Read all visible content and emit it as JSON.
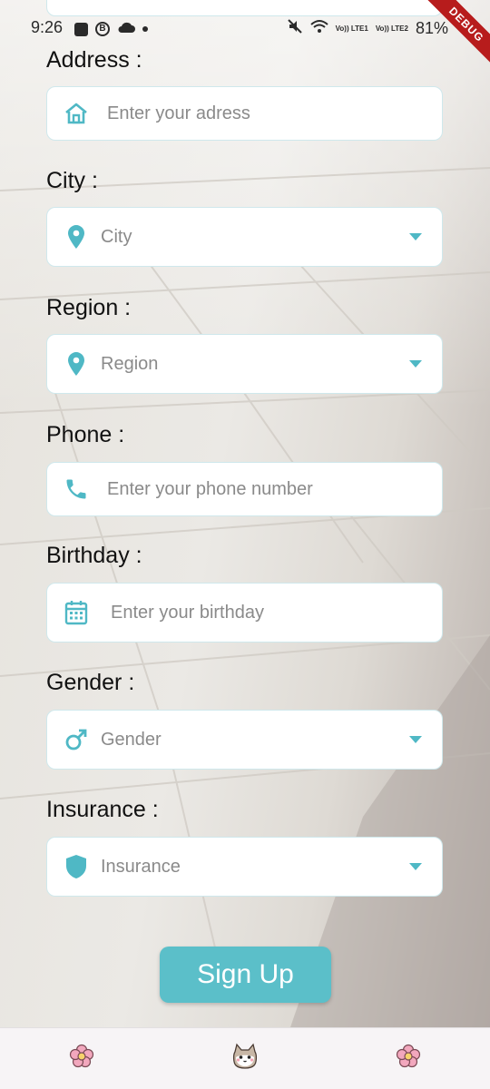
{
  "status_bar": {
    "time": "9:26",
    "battery": "81%",
    "debug_label": "DEBUG",
    "lte1": "Vo)) LTE1",
    "lte2": "Vo)) LTE2"
  },
  "form": {
    "address": {
      "label": "Address :",
      "placeholder": "Enter your adress",
      "icon": "home-icon"
    },
    "city": {
      "label": "City :",
      "placeholder": "City",
      "icon": "location-pin-icon"
    },
    "region": {
      "label": "Region :",
      "placeholder": "Region",
      "icon": "location-pin-icon"
    },
    "phone": {
      "label": "Phone :",
      "placeholder": "Enter your phone number",
      "icon": "phone-icon"
    },
    "birthday": {
      "label": "Birthday :",
      "placeholder": "Enter your birthday",
      "icon": "calendar-icon"
    },
    "gender": {
      "label": "Gender :",
      "placeholder": "Gender",
      "icon": "male-icon"
    },
    "insurance": {
      "label": "Insurance :",
      "placeholder": "Insurance",
      "icon": "shield-icon"
    }
  },
  "actions": {
    "signup_label": "Sign Up"
  },
  "colors": {
    "accent": "#4fb8c5",
    "button": "#5bbfc9",
    "field_border": "#cfe8ec"
  },
  "bottom_nav": {
    "items": [
      {
        "icon": "flower-icon"
      },
      {
        "icon": "cat-icon"
      },
      {
        "icon": "flower-icon"
      }
    ]
  }
}
